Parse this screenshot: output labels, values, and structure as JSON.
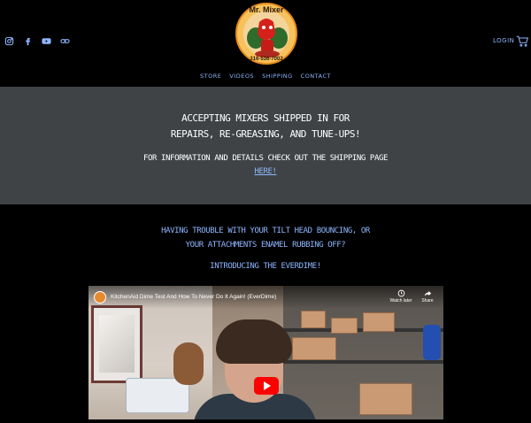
{
  "header": {
    "social": [
      {
        "icon": "instagram-icon"
      },
      {
        "icon": "facebook-icon"
      },
      {
        "icon": "youtube-icon"
      },
      {
        "icon": "link-icon"
      }
    ],
    "logo": {
      "title": "Mr. Mixer",
      "phone": "316-536-7002"
    },
    "login_label": "LOGIN",
    "nav": [
      "STORE",
      "VIDEOS",
      "SHIPPING",
      "CONTACT"
    ]
  },
  "banner": {
    "heading": "ACCEPTING MIXERS SHIPPED IN FOR REPAIRS, RE-GREASING, AND TUNE-UPS!",
    "subtext": "FOR INFORMATION AND DETAILS CHECK OUT THE SHIPPING PAGE",
    "link_text": "HERE!"
  },
  "promo": {
    "question": "HAVING TROUBLE WITH YOUR TILT HEAD BOUNCING, OR YOUR ATTACHMENTS ENAMEL RUBBING OFF?",
    "intro": "INTRODUCING THE EVERDIME!"
  },
  "video": {
    "title": "KitchenAid Dime Test And How To Never Do It Again! (EverDime)",
    "actions": [
      "Watch later",
      "Share"
    ]
  },
  "colors": {
    "background": "#000000",
    "banner_bg": "#3f4345",
    "accent_text": "#8fb7ff",
    "play_button": "#ff0000"
  }
}
